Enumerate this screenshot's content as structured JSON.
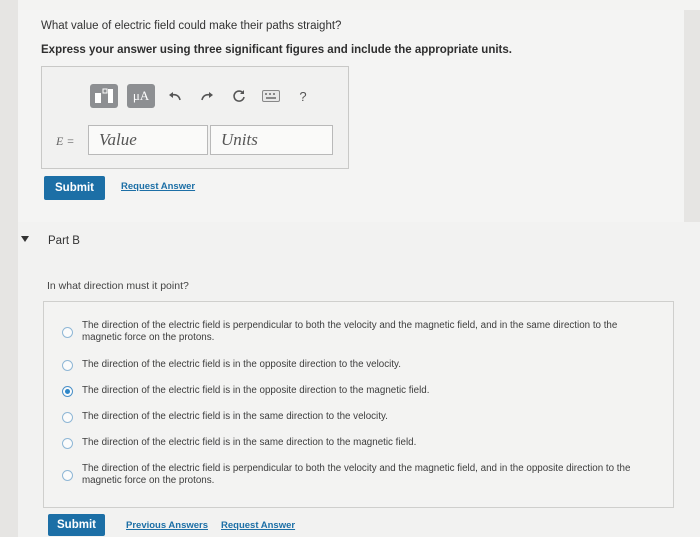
{
  "partA": {
    "question": "What value of electric field could make their paths straight?",
    "instruction": "Express your answer using three significant figures and include the appropriate units.",
    "toolbar": {
      "templates_icon": "templates-icon",
      "units_label": "μA",
      "undo_icon": "undo-icon",
      "redo_icon": "redo-icon",
      "reset_icon": "reset-icon",
      "keyboard_icon": "keyboard-icon",
      "help_label": "?"
    },
    "variable_label": "E =",
    "value_placeholder": "Value",
    "units_placeholder": "Units",
    "submit_label": "Submit",
    "request_answer_label": "Request Answer"
  },
  "partB": {
    "title": "Part B",
    "question": "In what direction must it point?",
    "options": [
      "The direction of the electric field is perpendicular to both the velocity and the magnetic field, and in the same direction to the magnetic force on the protons.",
      "The direction of the electric field is in the opposite direction to the velocity.",
      "The direction of the electric field is in the opposite direction to the magnetic field.",
      "The direction of the electric field is in the same direction to the velocity.",
      "The direction of the electric field is in the same direction to the magnetic field.",
      "The direction of the electric field is perpendicular to both the velocity and the magnetic field, and in the opposite direction to the magnetic force on the protons."
    ],
    "selected_index": 2,
    "submit_label": "Submit",
    "previous_answers_label": "Previous Answers",
    "request_answer_label": "Request Answer"
  },
  "colors": {
    "primary": "#1c6fa6",
    "radio_selected": "#2e86c8",
    "toolbar_button": "#8d8f92"
  }
}
